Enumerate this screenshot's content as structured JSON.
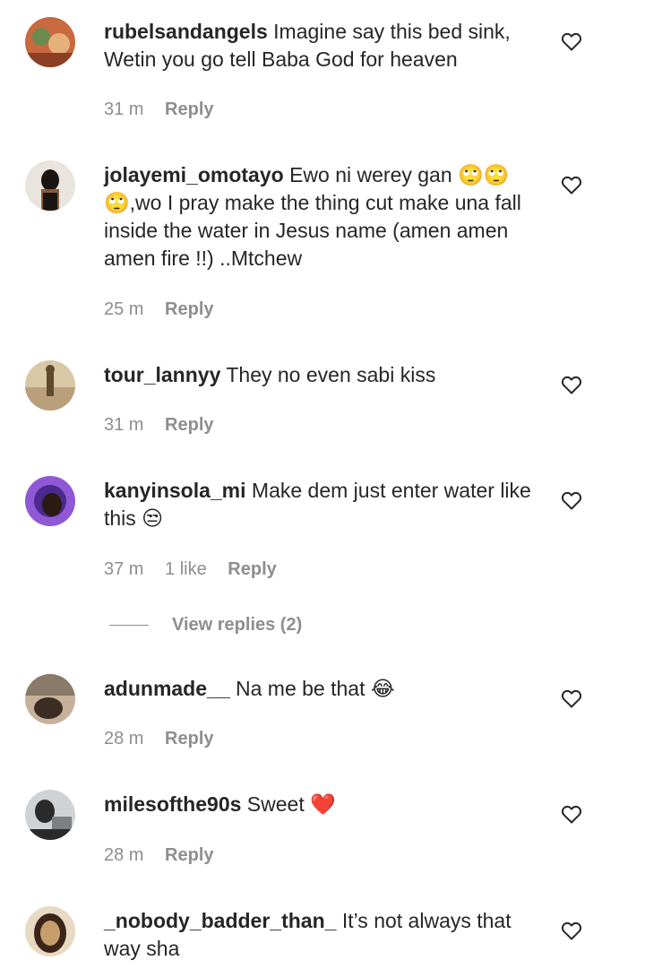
{
  "comments": [
    {
      "username": "rubelsandangels",
      "text": "Imagine say this bed sink, Wetin you go tell Baba God for heaven",
      "time": "31 m",
      "likes": "",
      "reply": "Reply",
      "avatar_colors": [
        "#c9693f",
        "#6c8a4e",
        "#e6b07a"
      ]
    },
    {
      "username": "jolayemi_omotayo",
      "text": "Ewo ni werey gan 🙄🙄🙄,wo I pray make the thing cut make una fall inside the water in Jesus name (amen amen amen fire !!) ..Mtchew",
      "time": "25 m",
      "likes": "",
      "reply": "Reply",
      "avatar_colors": [
        "#e9e4dd",
        "#1b1512",
        "#8a5a3d"
      ]
    },
    {
      "username": "tour_lannyy",
      "text": "They no even sabi kiss",
      "time": "31 m",
      "likes": "",
      "reply": "Reply",
      "avatar_colors": [
        "#b9a07a",
        "#5f4a2e",
        "#d9c8a6"
      ]
    },
    {
      "username": "kanyinsola_mi",
      "text": "Make dem just enter water like this 😒",
      "time": "37 m",
      "likes": "1 like",
      "reply": "Reply",
      "avatar_colors": [
        "#4a2a8e",
        "#8f59d6",
        "#2b1a12"
      ]
    },
    {
      "username": "adunmade__",
      "text": "Na me be that 😂",
      "time": "28 m",
      "likes": "",
      "reply": "Reply",
      "avatar_colors": [
        "#8a7a6a",
        "#3c2d24",
        "#c7b19a"
      ]
    },
    {
      "username": "milesofthe90s",
      "text": "Sweet ❤️",
      "time": "28 m",
      "likes": "",
      "reply": "Reply",
      "avatar_colors": [
        "#cfd3d6",
        "#2a2a2a",
        "#7b8085"
      ]
    },
    {
      "username": "_nobody_badder_than_",
      "text": "It’s not always that way sha",
      "time": "",
      "likes": "",
      "reply": "",
      "avatar_colors": [
        "#e8d9c2",
        "#3b2418",
        "#c89d6c"
      ]
    }
  ],
  "view_replies": "View replies (2)",
  "icons": {
    "like": "heart-outline-icon"
  }
}
